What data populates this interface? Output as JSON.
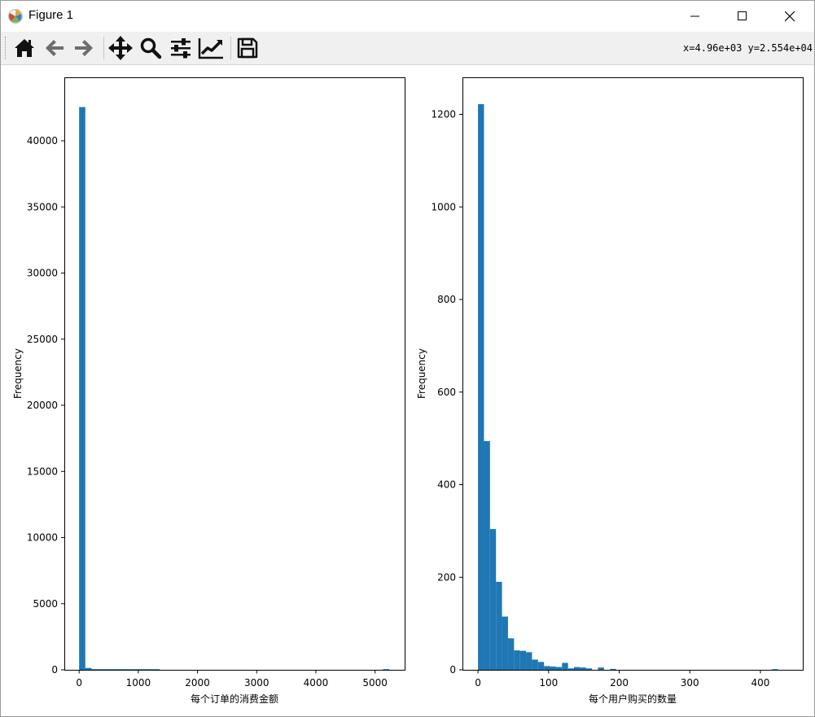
{
  "window": {
    "title": "Figure 1",
    "controls": {
      "minimize": "minimize",
      "maximize": "maximize",
      "close": "close"
    }
  },
  "toolbar": {
    "buttons": [
      {
        "name": "home-button",
        "icon": "home-icon",
        "tooltip": "Reset original view"
      },
      {
        "name": "back-button",
        "icon": "arrow-left-icon",
        "tooltip": "Back to previous view"
      },
      {
        "name": "forward-button",
        "icon": "arrow-right-icon",
        "tooltip": "Forward to next view"
      },
      {
        "name": "pan-button",
        "icon": "move-icon",
        "tooltip": "Pan axes"
      },
      {
        "name": "zoom-button",
        "icon": "magnifier-icon",
        "tooltip": "Zoom to rectangle"
      },
      {
        "name": "subplots-button",
        "icon": "sliders-icon",
        "tooltip": "Configure subplots"
      },
      {
        "name": "edit-axes-button",
        "icon": "line-chart-icon",
        "tooltip": "Edit axis"
      },
      {
        "name": "save-button",
        "icon": "floppy-disk-icon",
        "tooltip": "Save the figure"
      }
    ],
    "coordinates": "x=4.96e+03 y=2.554e+04"
  },
  "colors": {
    "bar": "#1f77b4",
    "axis": "#000000",
    "toolbar_bg": "#f0f0f0"
  },
  "chart_data": [
    {
      "type": "bar",
      "subtype": "histogram",
      "xlabel": "每个订单的消费金额",
      "ylabel": "Frequency",
      "xlim": [
        -250,
        5500
      ],
      "ylim": [
        0,
        44800
      ],
      "xticks": [
        0,
        1000,
        2000,
        3000,
        4000,
        5000
      ],
      "yticks": [
        0,
        5000,
        10000,
        15000,
        20000,
        25000,
        30000,
        35000,
        40000
      ],
      "bin_width": 104.8,
      "bins_start": 0,
      "values": [
        42550,
        140,
        40,
        15,
        8,
        5,
        3,
        2,
        2,
        1,
        1,
        1,
        1,
        0,
        0,
        0,
        0,
        0,
        0,
        0,
        0,
        0,
        0,
        0,
        0,
        0,
        0,
        0,
        0,
        0,
        0,
        0,
        0,
        0,
        0,
        0,
        0,
        0,
        0,
        0,
        0,
        0,
        0,
        0,
        0,
        0,
        0,
        0,
        0,
        1
      ],
      "grid": false,
      "legend": "none"
    },
    {
      "type": "bar",
      "subtype": "histogram",
      "xlabel": "每个用户购买的数量",
      "ylabel": "Frequency",
      "xlim": [
        -22,
        460
      ],
      "ylim": [
        0,
        1280
      ],
      "xticks": [
        0,
        100,
        200,
        300,
        400
      ],
      "yticks": [
        0,
        200,
        400,
        600,
        800,
        1000,
        1200
      ],
      "bin_width": 8.5,
      "bins_start": 0,
      "values": [
        1222,
        494,
        304,
        190,
        115,
        68,
        42,
        41,
        38,
        22,
        17,
        8,
        7,
        6,
        15,
        3,
        6,
        5,
        3,
        0,
        5,
        0,
        2,
        0,
        0,
        0,
        0,
        0,
        0,
        0,
        0,
        0,
        0,
        0,
        0,
        0,
        0,
        0,
        0,
        0,
        0,
        0,
        0,
        0,
        0,
        0,
        0,
        0,
        0,
        1
      ],
      "grid": false,
      "legend": "none"
    }
  ]
}
